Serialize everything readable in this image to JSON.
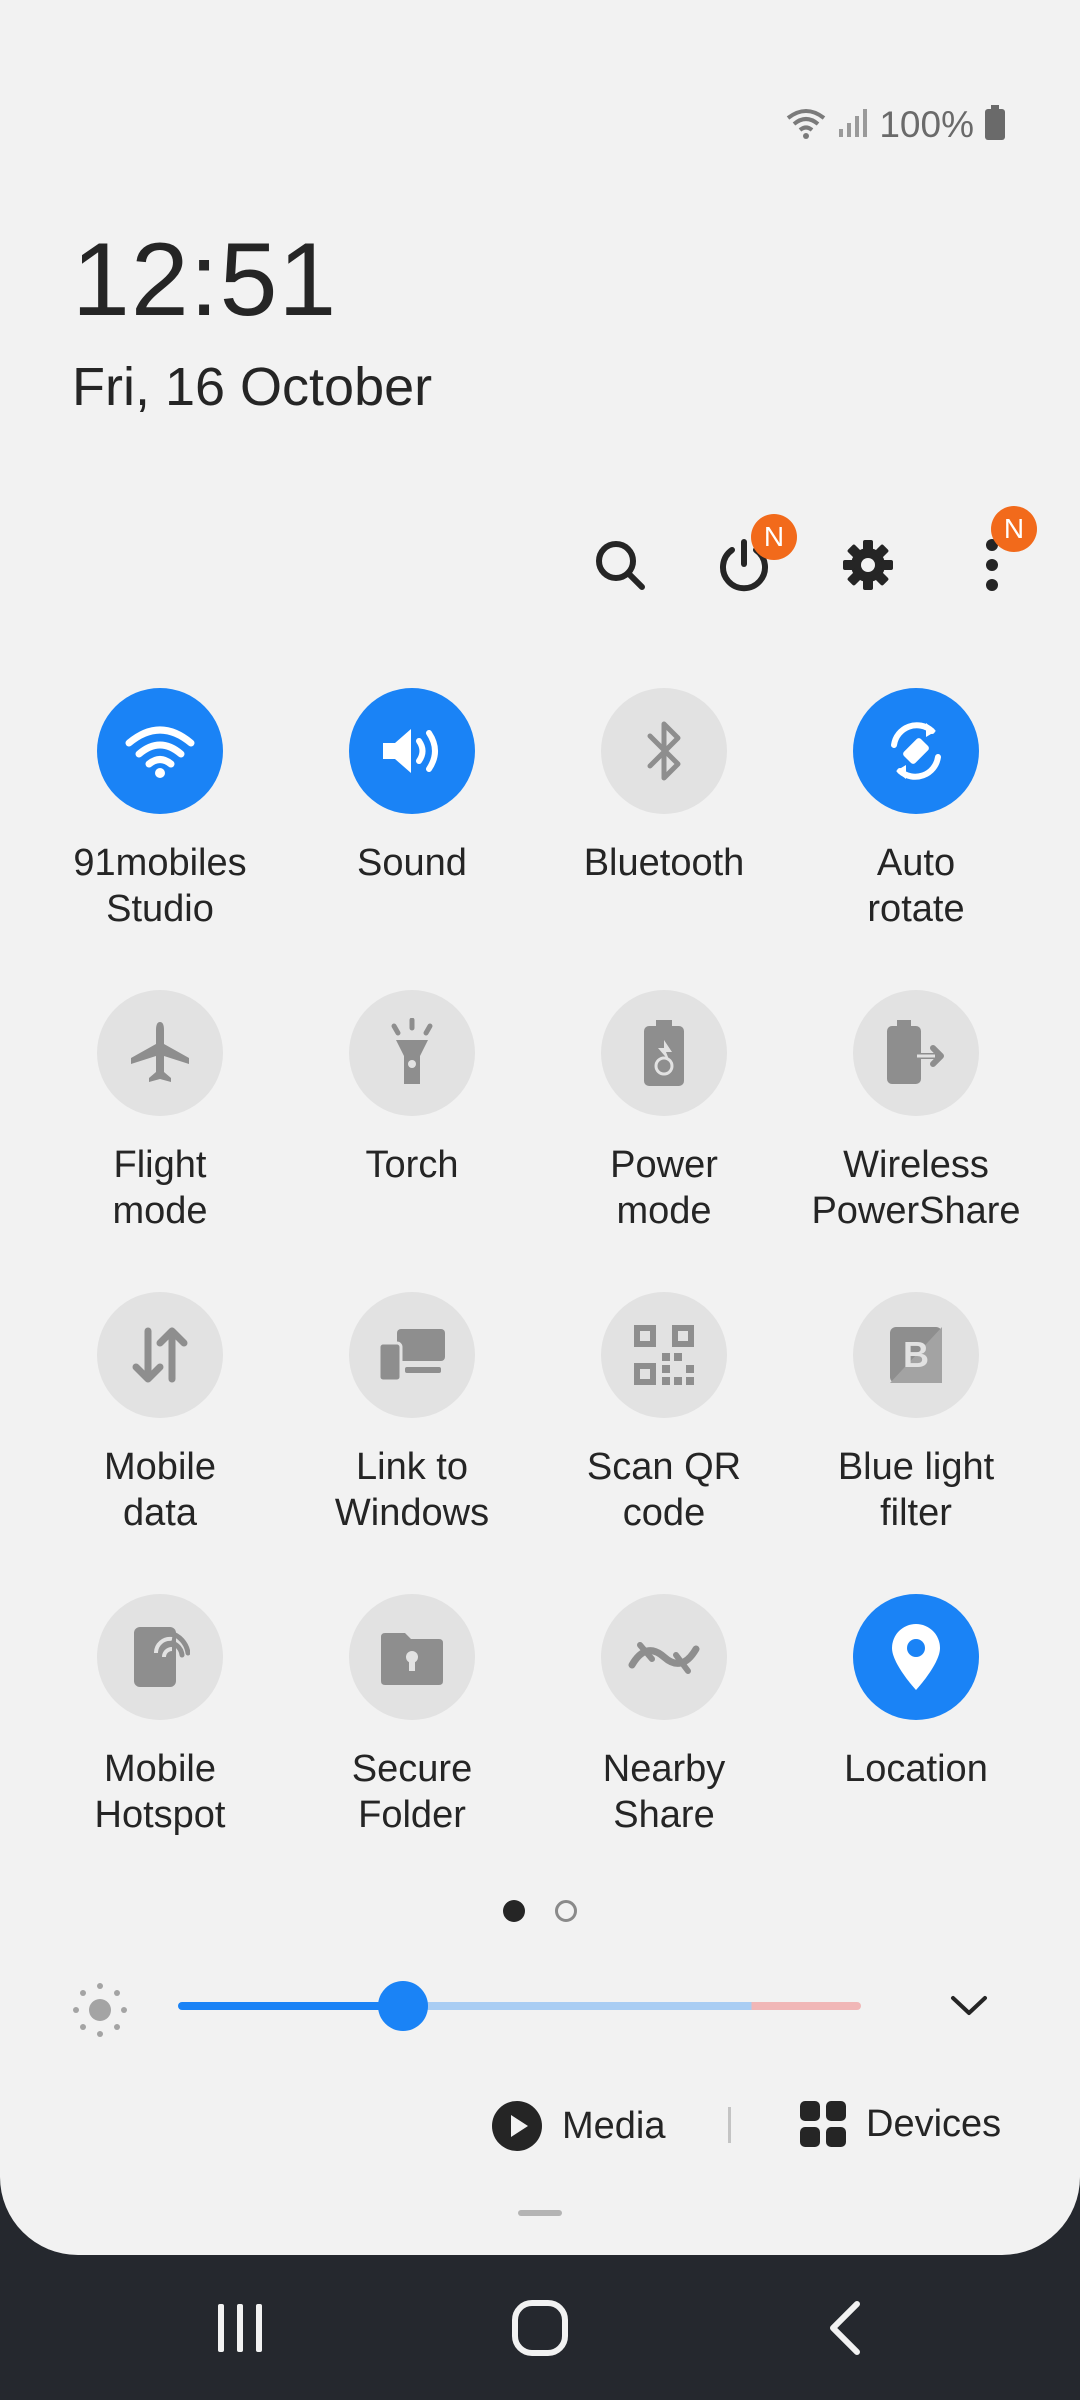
{
  "status_bar": {
    "battery_percent": "100%",
    "icons": [
      "wifi-icon",
      "cellular-signal-icon",
      "battery-icon"
    ],
    "battery_level": 1.0
  },
  "clock": {
    "time": "12:51",
    "date": "Fri, 16 October"
  },
  "header_actions": [
    {
      "name": "search-icon"
    },
    {
      "name": "power-icon",
      "badge": "N"
    },
    {
      "name": "settings-gear-icon"
    },
    {
      "name": "more-options-icon",
      "badge": "N"
    }
  ],
  "tiles": [
    {
      "label": "91mobiles\nStudio",
      "icon": "wifi-icon",
      "active": true
    },
    {
      "label": "Sound",
      "icon": "sound-icon",
      "active": true
    },
    {
      "label": "Bluetooth",
      "icon": "bluetooth-icon",
      "active": false
    },
    {
      "label": "Auto\nrotate",
      "icon": "auto-rotate-icon",
      "active": true
    },
    {
      "label": "Flight\nmode",
      "icon": "airplane-icon",
      "active": false
    },
    {
      "label": "Torch",
      "icon": "torch-icon",
      "active": false
    },
    {
      "label": "Power\nmode",
      "icon": "power-mode-icon",
      "active": false
    },
    {
      "label": "Wireless\nPowerShare",
      "icon": "wireless-powershare-icon",
      "active": false
    },
    {
      "label": "Mobile\ndata",
      "icon": "mobile-data-icon",
      "active": false
    },
    {
      "label": "Link to\nWindows",
      "icon": "link-to-windows-icon",
      "active": false
    },
    {
      "label": "Scan QR\ncode",
      "icon": "qr-code-icon",
      "active": false
    },
    {
      "label": "Blue light\nfilter",
      "icon": "blue-light-filter-icon",
      "active": false
    },
    {
      "label": "Mobile\nHotspot",
      "icon": "hotspot-icon",
      "active": false
    },
    {
      "label": "Secure\nFolder",
      "icon": "secure-folder-icon",
      "active": false
    },
    {
      "label": "Nearby\nShare",
      "icon": "nearby-share-icon",
      "active": false
    },
    {
      "label": "Location",
      "icon": "location-icon",
      "active": true
    }
  ],
  "pagination": {
    "pages": 2,
    "current": 1
  },
  "brightness": {
    "level": 0.33
  },
  "media": {
    "media_label": "Media",
    "devices_label": "Devices"
  },
  "colors": {
    "accent": "#1a83f6",
    "badge": "#f26a1b",
    "panel_bg": "#f2f2f2",
    "tile_off": "#e2e2e2",
    "nav_bg": "#25282e"
  },
  "navbar": {
    "buttons": [
      "recents-icon",
      "home-icon",
      "back-icon"
    ]
  }
}
